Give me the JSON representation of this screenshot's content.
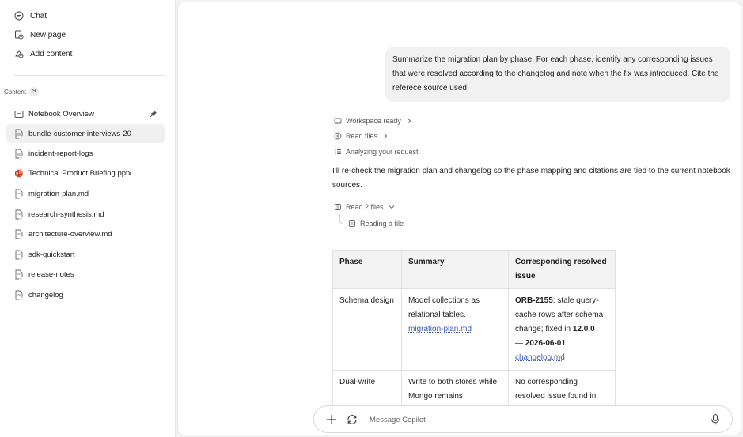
{
  "sidebar": {
    "nav": [
      {
        "label": "Chat",
        "icon": "chat-icon"
      },
      {
        "label": "New page",
        "icon": "new-page-icon"
      },
      {
        "label": "Add content",
        "icon": "add-content-icon"
      }
    ],
    "content_label": "Content",
    "content_count": "9",
    "files": [
      {
        "label": "Notebook Overview",
        "icon": "notebook-icon"
      },
      {
        "label": "bundle-customer-interviews-20",
        "icon": "file-icon",
        "more": "···"
      },
      {
        "label": "incident-report-logs",
        "icon": "file-icon"
      },
      {
        "label": "Technical Product Briefing.pptx",
        "icon": "powerpoint-icon"
      },
      {
        "label": "migration-plan.md",
        "icon": "markdown-icon"
      },
      {
        "label": "research-synthesis.md",
        "icon": "markdown-icon"
      },
      {
        "label": "architecture-overview.md",
        "icon": "markdown-icon"
      },
      {
        "label": "sdk-quickstart",
        "icon": "markdown-icon"
      },
      {
        "label": "release-notes",
        "icon": "markdown-icon"
      },
      {
        "label": "changelog",
        "icon": "markdown-icon"
      }
    ]
  },
  "chat": {
    "user_message": "Summarize the migration plan by phase. For each phase, identify any corresponding issues that were resolved according to the changelog and note when the fix was introduced. Cite the referece source used",
    "steps": {
      "workspace": "Workspace ready",
      "read_files": "Read files",
      "analyzing": "Analyzing your request",
      "read_two": "Read 2 files",
      "reading": "Reading a file"
    },
    "answer_text": "I'll re-check the migration plan and changelog so the phase mapping and citations are tied to the current notebook sources.",
    "table": {
      "headers": [
        "Phase",
        "Summary",
        "Corresponding resolved issue"
      ],
      "rows": [
        {
          "phase": "Schema design",
          "summary": "Model collections as relational tables.",
          "summary_cite": "migration-plan.md",
          "issue_id": "ORB-2155",
          "issue_text": ": stale query-cache rows after schema change; fixed in ",
          "issue_version": "12.0.0",
          "issue_sep": " — ",
          "issue_date": "2026-06-01",
          "issue_end": ".",
          "issue_cite": "changelog.md"
        },
        {
          "phase": "Dual-write",
          "summary": "Write to both stores while Mongo remains",
          "issue_text": "No corresponding resolved issue found in"
        }
      ]
    }
  },
  "composer": {
    "placeholder": "Message Copilot"
  }
}
